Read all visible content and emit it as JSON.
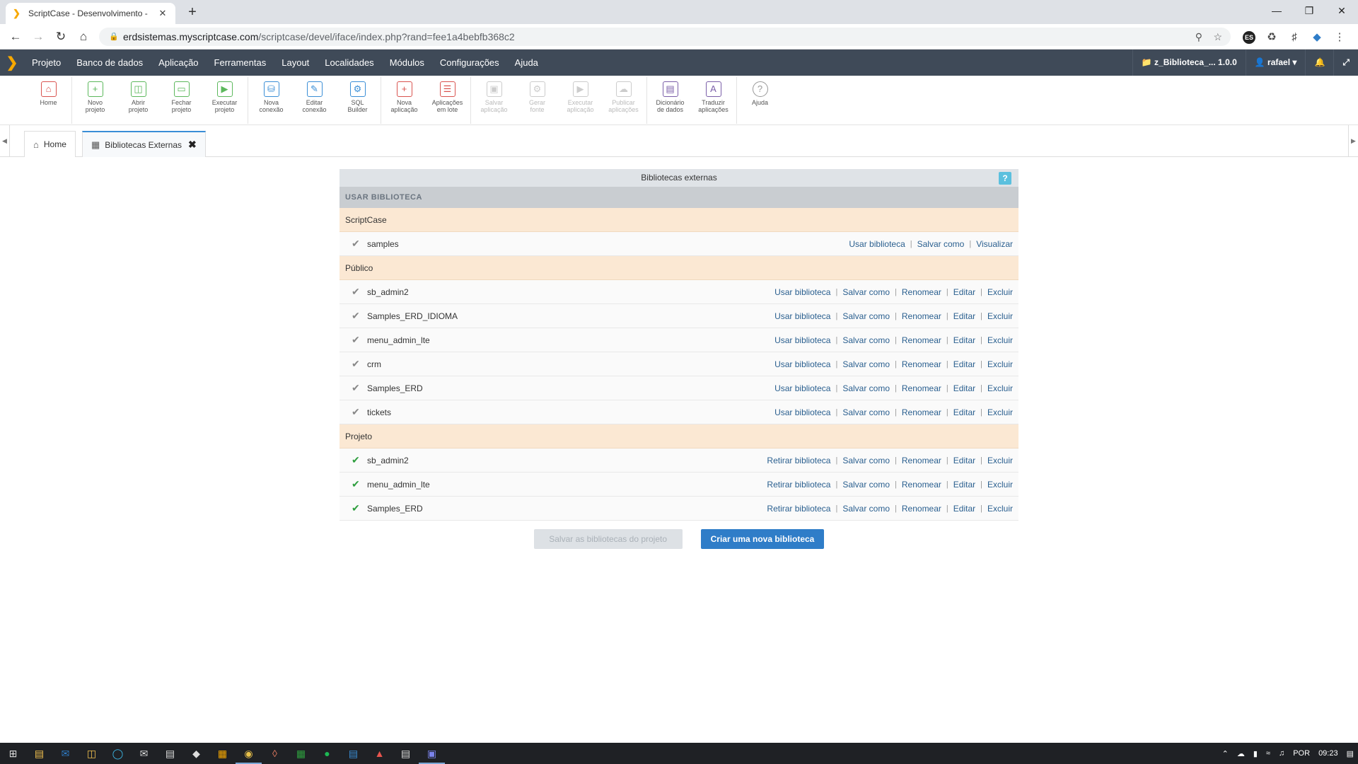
{
  "browser": {
    "tab_title": "ScriptCase - Desenvolvimento - ",
    "url_host": "erdsistemas.myscriptcase.com",
    "url_path": "/scriptcase/devel/iface/index.php?rand=fee1a4bebfb368c2",
    "ext_badge": "ES"
  },
  "menu": {
    "items": [
      "Projeto",
      "Banco de dados",
      "Aplicação",
      "Ferramentas",
      "Layout",
      "Localidades",
      "Módulos",
      "Configurações",
      "Ajuda"
    ],
    "project_label": "z_Biblioteca_... 1.0.0",
    "user_label": "rafael"
  },
  "toolbar": {
    "home": "Home",
    "novo_projeto": [
      "Novo",
      "projeto"
    ],
    "abrir_projeto": [
      "Abrir",
      "projeto"
    ],
    "fechar_projeto": [
      "Fechar",
      "projeto"
    ],
    "executar_projeto": [
      "Executar",
      "projeto"
    ],
    "nova_conexao": [
      "Nova",
      "conexão"
    ],
    "editar_conexao": [
      "Editar",
      "conexão"
    ],
    "sql_builder": [
      "SQL",
      "Builder"
    ],
    "nova_aplicacao": [
      "Nova",
      "aplicação"
    ],
    "aplicacoes_lote": [
      "Aplicações",
      "em lote"
    ],
    "salvar_aplicacao": [
      "Salvar",
      "aplicação"
    ],
    "gerar_fonte": [
      "Gerar",
      "fonte"
    ],
    "executar_aplicacao": [
      "Executar",
      "aplicação"
    ],
    "publicar_aplicacoes": [
      "Publicar",
      "aplicações"
    ],
    "dicionario_dados": [
      "Dicionário",
      "de dados"
    ],
    "traduzir_aplicacoes": [
      "Traduzir",
      "aplicações"
    ],
    "ajuda": "Ajuda"
  },
  "tabs": {
    "home": "Home",
    "bibliotecas": "Bibliotecas Externas"
  },
  "panel": {
    "title": "Bibliotecas externas",
    "help": "?",
    "subtitle": "USAR BIBLIOTECA",
    "groups": {
      "scriptcase": "ScriptCase",
      "publico": "Público",
      "projeto": "Projeto"
    },
    "actions": {
      "usar": "Usar biblioteca",
      "retirar": "Retirar biblioteca",
      "salvar": "Salvar como",
      "visualizar": "Visualizar",
      "renomear": "Renomear",
      "editar": "Editar",
      "excluir": "Excluir",
      "sep": "|"
    },
    "scriptcase_rows": [
      "samples"
    ],
    "publico_rows": [
      "sb_admin2",
      "Samples_ERD_IDIOMA",
      "menu_admin_lte",
      "crm",
      "Samples_ERD",
      "tickets"
    ],
    "projeto_rows": [
      "sb_admin2",
      "menu_admin_lte",
      "Samples_ERD"
    ],
    "btn_salvar": "Salvar as bibliotecas do projeto",
    "btn_criar": "Criar uma nova biblioteca"
  },
  "taskbar": {
    "lang": "POR",
    "time": "09:23"
  }
}
